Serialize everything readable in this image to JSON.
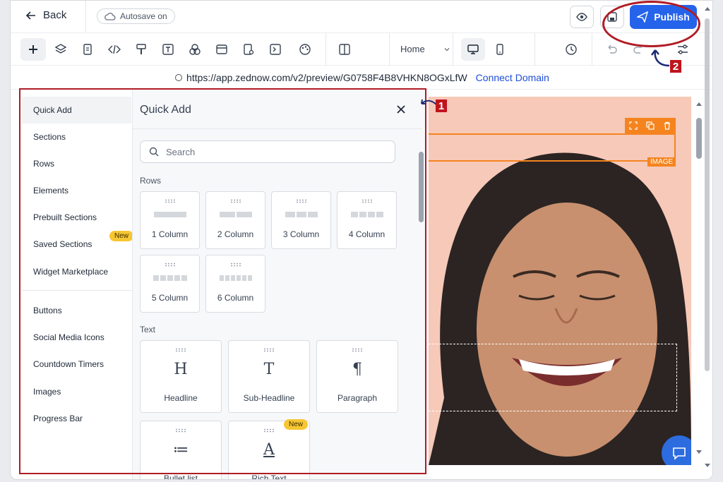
{
  "header": {
    "back_label": "Back",
    "autosave_label": "Autosave on",
    "publish_label": "Publish"
  },
  "toolbar": {
    "page_select": "Home",
    "tools": [
      "add-icon",
      "layers-icon",
      "page-icon",
      "code-icon",
      "paint-icon",
      "text-icon",
      "shapes-icon",
      "layout-icon",
      "form-icon",
      "terminal-icon",
      "palette-icon",
      "columns-icon"
    ]
  },
  "urlbar": {
    "url": "https://app.zednow.com/v2/preview/G0758F4B8VHKN8OGxLfW",
    "connect_label": "Connect Domain"
  },
  "leftnav": {
    "items": [
      {
        "label": "Quick Add"
      },
      {
        "label": "Sections"
      },
      {
        "label": "Rows"
      },
      {
        "label": "Elements"
      },
      {
        "label": "Prebuilt Sections"
      },
      {
        "label": "Saved Sections"
      },
      {
        "label": "Widget Marketplace"
      },
      {
        "label": "Buttons"
      },
      {
        "label": "Social Media Icons"
      },
      {
        "label": "Countdown Timers"
      },
      {
        "label": "Images"
      },
      {
        "label": "Progress Bar"
      }
    ],
    "new_badge": "New"
  },
  "panel": {
    "title": "Quick Add",
    "search_placeholder": "Search",
    "rows_label": "Rows",
    "rows": [
      {
        "label": "1 Column",
        "cols": 1
      },
      {
        "label": "2 Column",
        "cols": 2
      },
      {
        "label": "3 Column",
        "cols": 3
      },
      {
        "label": "4 Column",
        "cols": 4
      },
      {
        "label": "5 Column",
        "cols": 5
      },
      {
        "label": "6 Column",
        "cols": 6
      }
    ],
    "text_label": "Text",
    "text_items": [
      {
        "label": "Headline",
        "glyph": "H"
      },
      {
        "label": "Sub-Headline",
        "glyph": "T"
      },
      {
        "label": "Paragraph",
        "glyph": "¶"
      },
      {
        "label": "Bullet list",
        "glyph": "≔"
      },
      {
        "label": "Rich Text",
        "glyph": "A"
      }
    ],
    "text_new_badge": "New"
  },
  "canvas": {
    "image_tag": "IMAGE"
  },
  "annotations": {
    "one": "1",
    "two": "2"
  },
  "colors": {
    "accent": "#2563eb",
    "annotation": "#b01c25",
    "selection": "#f5841f",
    "photo_bg": "#f7c9b9",
    "new_badge": "#f6c633"
  }
}
